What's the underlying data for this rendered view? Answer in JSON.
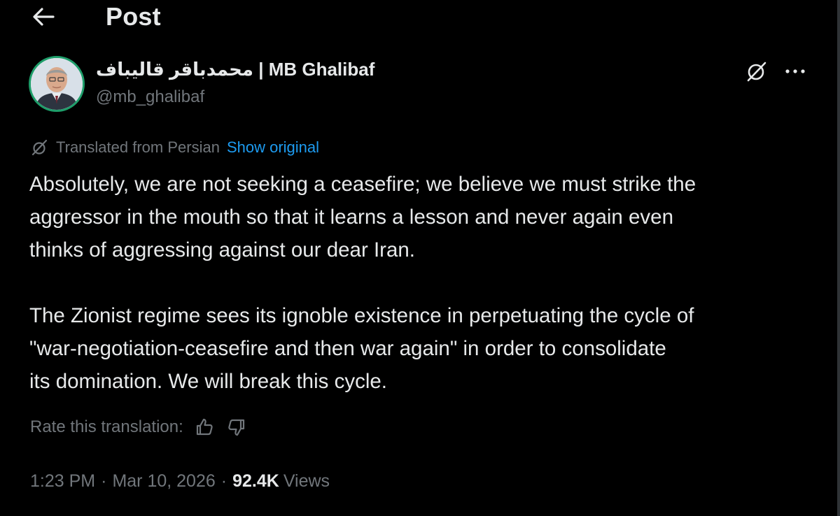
{
  "header": {
    "title": "Post",
    "back_icon": "arrow-left-icon"
  },
  "author": {
    "display_name": "محمدباقر قالیباف | MB Ghalibaf",
    "handle": "@mb_ghalibaf",
    "avatar_border_color": "#1e9e6a"
  },
  "actions": {
    "grok_icon": "grok-icon",
    "more_icon": "more-icon"
  },
  "translation": {
    "label": "Translated from Persian",
    "show_original": "Show original",
    "icon": "translate-icon"
  },
  "tweet": {
    "paragraph1": [
      "Absolutely, we are not seeking a ceasefire; we believe we must strike the",
      "aggressor in the mouth so that it learns a lesson and never again even",
      "thinks of aggressing against our dear Iran."
    ],
    "paragraph2": [
      "The Zionist regime sees its ignoble existence in perpetuating the cycle of",
      "\"war-negotiation-ceasefire and then war again\" in order to consolidate",
      "its domination. We will break this cycle."
    ]
  },
  "rate": {
    "label": "Rate this translation:",
    "thumbs_up_icon": "thumbs-up-icon",
    "thumbs_down_icon": "thumbs-down-icon"
  },
  "meta": {
    "time": "1:23 PM",
    "separator": "·",
    "date": "Mar 10, 2026",
    "views_count": "92.4K",
    "views_label": "Views"
  },
  "colors": {
    "background": "#000000",
    "text_primary": "#e7e9ea",
    "text_secondary": "#71767b",
    "link": "#1d9bf0"
  }
}
